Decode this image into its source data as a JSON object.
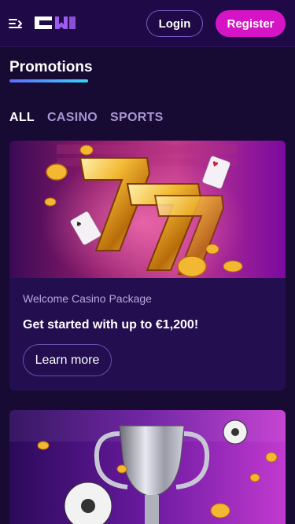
{
  "header": {
    "menu_icon": "menu-arrow-icon",
    "logo_icon": "cw-logo",
    "login_label": "Login",
    "register_label": "Register"
  },
  "page": {
    "title": "Promotions"
  },
  "tabs": [
    {
      "label": "ALL",
      "active": true
    },
    {
      "label": "CASINO",
      "active": false
    },
    {
      "label": "SPORTS",
      "active": false
    }
  ],
  "promotions": [
    {
      "image_icon": "lucky-sevens-image",
      "category": "Welcome Casino Package",
      "headline": "Get started with up to €1,200!",
      "button_label": "Learn more"
    },
    {
      "image_icon": "trophy-football-image"
    }
  ],
  "colors": {
    "background": "#170a33",
    "header": "#1f0a47",
    "card": "#230e4f",
    "register": "#d514c6",
    "accent_gradient_start": "#5f6bff",
    "accent_gradient_end": "#34d6f5"
  }
}
